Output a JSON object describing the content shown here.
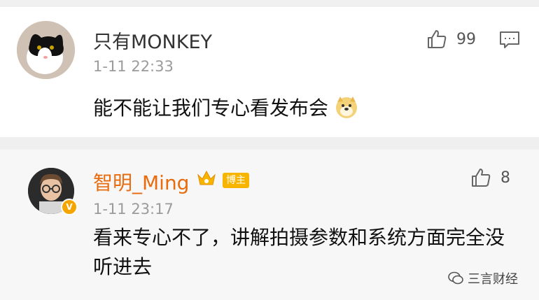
{
  "comments": [
    {
      "username": "只有MONKEY",
      "time": "1-11 22:33",
      "likes": "99",
      "content": "能不能让我们专心看发布会"
    },
    {
      "username": "智明_Ming",
      "badge": "博主",
      "time": "1-11 23:17",
      "likes": "8",
      "content": "看来专心不了，讲解拍摄参数和系统方面完全没听进去"
    }
  ],
  "watermark": {
    "label": "三言财经"
  },
  "colors": {
    "blogger_name": "#e86b0e",
    "badge_bg": "#f7b500",
    "v_badge": "#f6a500"
  }
}
